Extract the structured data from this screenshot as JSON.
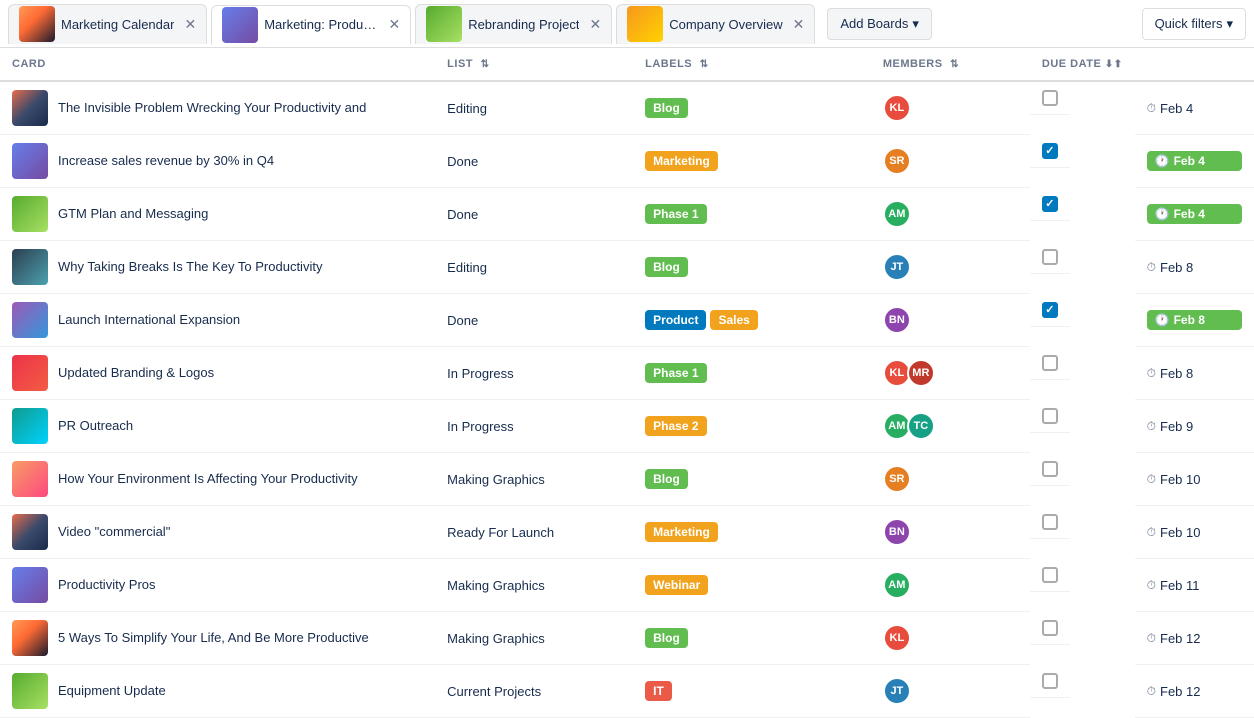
{
  "tabs": [
    {
      "id": "marketing-calendar",
      "label": "Marketing Calendar",
      "thumb_class": "thumb-sunset",
      "active": false
    },
    {
      "id": "marketing-product",
      "label": "Marketing: Product Lau...",
      "thumb_class": "thumb-blue",
      "active": true
    },
    {
      "id": "rebranding",
      "label": "Rebranding Project",
      "thumb_class": "thumb-green",
      "active": false
    },
    {
      "id": "company-overview",
      "label": "Company Overview",
      "thumb_class": "thumb-orange",
      "active": false
    }
  ],
  "add_boards_label": "Add Boards",
  "quick_filters_label": "Quick filters",
  "columns": [
    {
      "id": "card",
      "label": "CARD",
      "sortable": false
    },
    {
      "id": "list",
      "label": "LIST",
      "sortable": true
    },
    {
      "id": "labels",
      "label": "LABELS",
      "sortable": true
    },
    {
      "id": "members",
      "label": "MEMBERS",
      "sortable": true
    },
    {
      "id": "due_date",
      "label": "DUE DATE",
      "sortable": true
    }
  ],
  "rows": [
    {
      "id": 1,
      "title": "The Invisible Problem Wrecking Your Productivity and",
      "thumb_class": "thumb-mountain",
      "list": "Editing",
      "labels": [
        {
          "text": "Blog",
          "class": "label-blog"
        }
      ],
      "avatars": [
        {
          "class": "av1",
          "initials": "KL"
        }
      ],
      "due_date": "Feb 4",
      "due_badge": false,
      "checked": false
    },
    {
      "id": 2,
      "title": "Increase sales revenue by 30% in Q4",
      "thumb_class": "thumb-blue",
      "list": "Done",
      "labels": [
        {
          "text": "Marketing",
          "class": "label-marketing"
        }
      ],
      "avatars": [
        {
          "class": "av2",
          "initials": "SR"
        }
      ],
      "due_date": "Feb 4",
      "due_badge": true,
      "checked": true
    },
    {
      "id": 3,
      "title": "GTM Plan and Messaging",
      "thumb_class": "thumb-green",
      "list": "Done",
      "labels": [
        {
          "text": "Phase 1",
          "class": "label-phase1"
        }
      ],
      "avatars": [
        {
          "class": "av3",
          "initials": "AM"
        }
      ],
      "due_date": "Feb 4",
      "due_badge": true,
      "checked": true
    },
    {
      "id": 4,
      "title": "Why Taking Breaks Is The Key To Productivity",
      "thumb_class": "thumb-dark",
      "list": "Editing",
      "labels": [
        {
          "text": "Blog",
          "class": "label-blog"
        }
      ],
      "avatars": [
        {
          "class": "av4",
          "initials": "JT"
        }
      ],
      "due_date": "Feb 8",
      "due_badge": false,
      "checked": false
    },
    {
      "id": 5,
      "title": "Launch International Expansion",
      "thumb_class": "thumb-purple",
      "list": "Done",
      "labels": [
        {
          "text": "Product",
          "class": "label-product"
        },
        {
          "text": "Sales",
          "class": "label-sales"
        }
      ],
      "avatars": [
        {
          "class": "av5",
          "initials": "BN"
        }
      ],
      "due_date": "Feb 8",
      "due_badge": true,
      "checked": true
    },
    {
      "id": 6,
      "title": "Updated Branding & Logos",
      "thumb_class": "thumb-red",
      "list": "In Progress",
      "labels": [
        {
          "text": "Phase 1",
          "class": "label-phase1"
        }
      ],
      "avatars": [
        {
          "class": "av1",
          "initials": "KL"
        },
        {
          "class": "av6",
          "initials": "MR"
        }
      ],
      "due_date": "Feb 8",
      "due_badge": false,
      "checked": false
    },
    {
      "id": 7,
      "title": "PR Outreach",
      "thumb_class": "thumb-teal",
      "list": "In Progress",
      "labels": [
        {
          "text": "Phase 2",
          "class": "label-phase2"
        }
      ],
      "avatars": [
        {
          "class": "av3",
          "initials": "AM"
        },
        {
          "class": "av7",
          "initials": "TC"
        }
      ],
      "due_date": "Feb 9",
      "due_badge": false,
      "checked": false
    },
    {
      "id": 8,
      "title": "How Your Environment Is Affecting Your Productivity",
      "thumb_class": "thumb-dawn",
      "list": "Making Graphics",
      "labels": [
        {
          "text": "Blog",
          "class": "label-blog"
        }
      ],
      "avatars": [
        {
          "class": "av2",
          "initials": "SR"
        }
      ],
      "due_date": "Feb 10",
      "due_badge": false,
      "checked": false
    },
    {
      "id": 9,
      "title": "Video \"commercial\"",
      "thumb_class": "thumb-mountain",
      "list": "Ready For Launch",
      "labels": [
        {
          "text": "Marketing",
          "class": "label-marketing"
        }
      ],
      "avatars": [
        {
          "class": "av5",
          "initials": "BN"
        }
      ],
      "due_date": "Feb 10",
      "due_badge": false,
      "checked": false
    },
    {
      "id": 10,
      "title": "Productivity Pros",
      "thumb_class": "thumb-blue",
      "list": "Making Graphics",
      "labels": [
        {
          "text": "Webinar",
          "class": "label-webinar"
        }
      ],
      "avatars": [
        {
          "class": "av3",
          "initials": "AM"
        }
      ],
      "due_date": "Feb 11",
      "due_badge": false,
      "checked": false
    },
    {
      "id": 11,
      "title": "5 Ways To Simplify Your Life, And Be More Productive",
      "thumb_class": "thumb-sunset",
      "list": "Making Graphics",
      "labels": [
        {
          "text": "Blog",
          "class": "label-blog"
        }
      ],
      "avatars": [
        {
          "class": "av1",
          "initials": "KL"
        }
      ],
      "due_date": "Feb 12",
      "due_badge": false,
      "checked": false
    },
    {
      "id": 12,
      "title": "Equipment Update",
      "thumb_class": "thumb-green",
      "list": "Current Projects",
      "labels": [
        {
          "text": "IT",
          "class": "label-it"
        }
      ],
      "avatars": [
        {
          "class": "av4",
          "initials": "JT"
        }
      ],
      "due_date": "Feb 12",
      "due_badge": false,
      "checked": false
    }
  ]
}
